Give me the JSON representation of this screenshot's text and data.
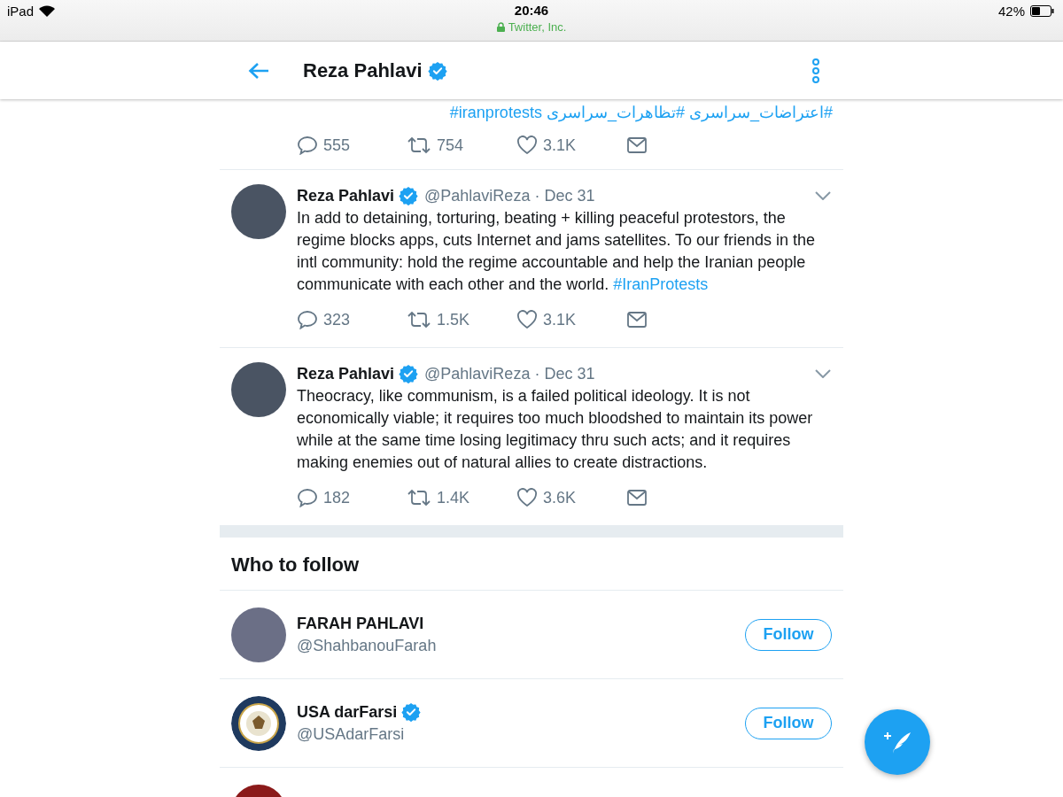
{
  "status_bar": {
    "device": "iPad",
    "time": "20:46",
    "site": "Twitter, Inc.",
    "battery": "42%"
  },
  "header": {
    "title": "Reza Pahlavi",
    "verified": true
  },
  "partial_tweet": {
    "hashtags": [
      "#اعتراضات_سراسری",
      "#تظاهرات_سراسری",
      "#iranprotests"
    ],
    "replies": "555",
    "retweets": "754",
    "likes": "3.1K"
  },
  "tweets": [
    {
      "name": "Reza Pahlavi",
      "verified": true,
      "handle": "@PahlaviReza",
      "separator": "·",
      "date": "Dec 31",
      "text": "In add to detaining, torturing, beating + killing peaceful protestors, the regime blocks apps, cuts Internet and jams satellites. To our friends in the intl community: hold the regime accountable and help the Iranian people communicate with each other and the world.",
      "hashtag": "#IranProtests",
      "replies": "323",
      "retweets": "1.5K",
      "likes": "3.1K"
    },
    {
      "name": "Reza Pahlavi",
      "verified": true,
      "handle": "@PahlaviReza",
      "separator": "·",
      "date": "Dec 31",
      "text": "Theocracy, like communism, is a failed political ideology. It is not economically viable; it requires too much bloodshed to maintain its power while at the same time losing legitimacy thru such acts; and it requires making enemies out of natural allies to create distractions.",
      "replies": "182",
      "retweets": "1.4K",
      "likes": "3.6K"
    }
  ],
  "who_to_follow": {
    "title": "Who to follow",
    "accounts": [
      {
        "kind": "photo",
        "name": "FARAH PAHLAVI",
        "verified": false,
        "handle": "@ShahbanouFarah",
        "button": "Follow"
      },
      {
        "kind": "seal",
        "name": "USA darFarsi",
        "verified": true,
        "handle": "@USAdarFarsi",
        "button": "Follow"
      },
      {
        "kind": "partial"
      }
    ]
  }
}
